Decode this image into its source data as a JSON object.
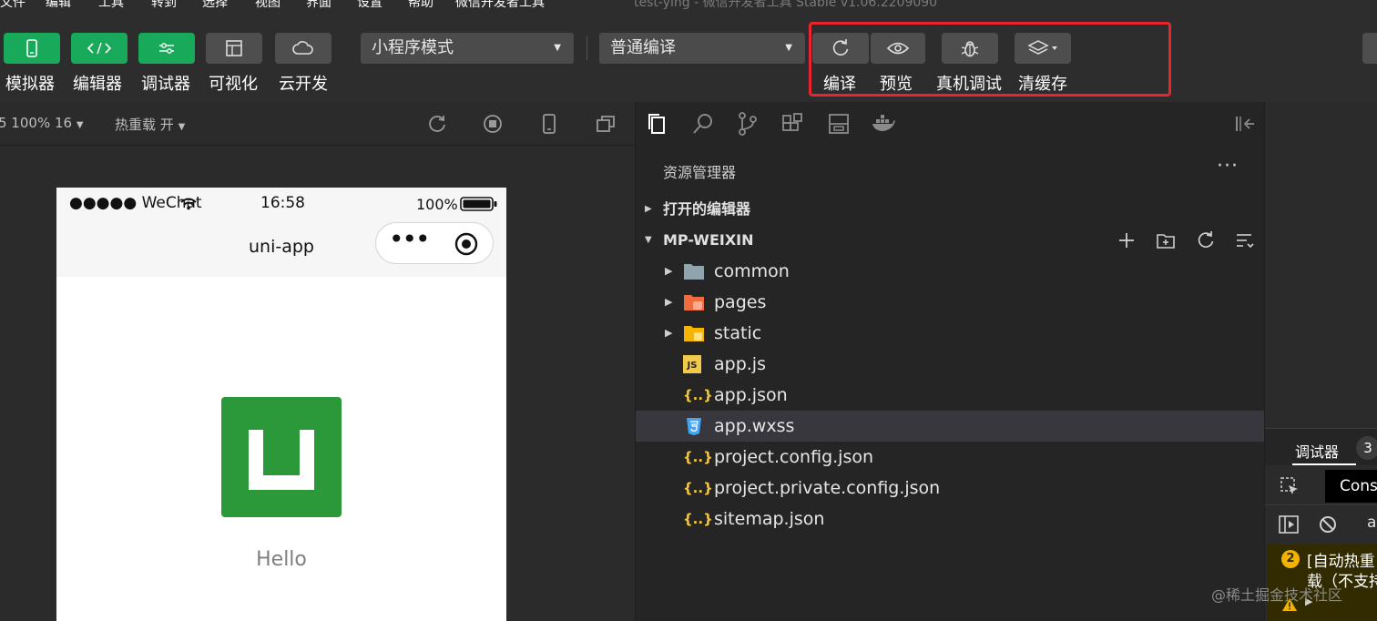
{
  "menubar": {
    "items": [
      "文件",
      "编辑",
      "工具",
      "转到",
      "选择",
      "视图",
      "界面",
      "设置",
      "帮助",
      "微信开发者工具"
    ],
    "title": "test-ying - 微信开发者工具 Stable v1.06.2209090"
  },
  "toolbar": {
    "buttons": [
      {
        "label": "模拟器",
        "icon": "phone-icon"
      },
      {
        "label": "编辑器",
        "icon": "code-icon"
      },
      {
        "label": "调试器",
        "icon": "sliders-icon"
      },
      {
        "label": "可视化",
        "icon": "layout-icon"
      },
      {
        "label": "云开发",
        "icon": "cloud-icon"
      }
    ],
    "mode_select": "小程序模式",
    "compile_select": "普通编译",
    "actions": [
      {
        "label": "编译",
        "icon": "refresh-icon"
      },
      {
        "label": "预览",
        "icon": "eye-icon"
      },
      {
        "label": "真机调试",
        "icon": "bug-icon"
      },
      {
        "label": "清缓存",
        "icon": "layers-icon"
      }
    ]
  },
  "simulator": {
    "zoom": "5 100% 16",
    "hot_reload": "热重载 开",
    "status": {
      "carrier": "●●●●● WeChat",
      "time": "16:58",
      "battery": "100%"
    },
    "nav_title": "uni-app",
    "capsule_dots": "•••",
    "hello": "Hello"
  },
  "explorer": {
    "title": "资源管理器",
    "more": "···",
    "open_editors": "打开的编辑器",
    "project": "MP-WEIXIN",
    "items": [
      {
        "name": "common",
        "type": "folder"
      },
      {
        "name": "pages",
        "type": "folder"
      },
      {
        "name": "static",
        "type": "folder"
      },
      {
        "name": "app.js",
        "type": "js"
      },
      {
        "name": "app.json",
        "type": "json"
      },
      {
        "name": "app.wxss",
        "type": "css"
      },
      {
        "name": "project.config.json",
        "type": "json"
      },
      {
        "name": "project.private.config.json",
        "type": "json"
      },
      {
        "name": "sitemap.json",
        "type": "json"
      }
    ],
    "js_badge": "JS",
    "json_badge": "{..}"
  },
  "debugger": {
    "tab": "调试器",
    "badge": "3",
    "console_tab": "Cons",
    "filter_text": "a",
    "warn_count": "2",
    "warn_line1": "[自动热重",
    "warn_line2": "载（不支持"
  },
  "watermark": "@稀土掘金技术社区",
  "colors": {
    "green_button": "#19a95a",
    "highlight_red": "#e8252c",
    "logo_green": "#2b9939"
  }
}
